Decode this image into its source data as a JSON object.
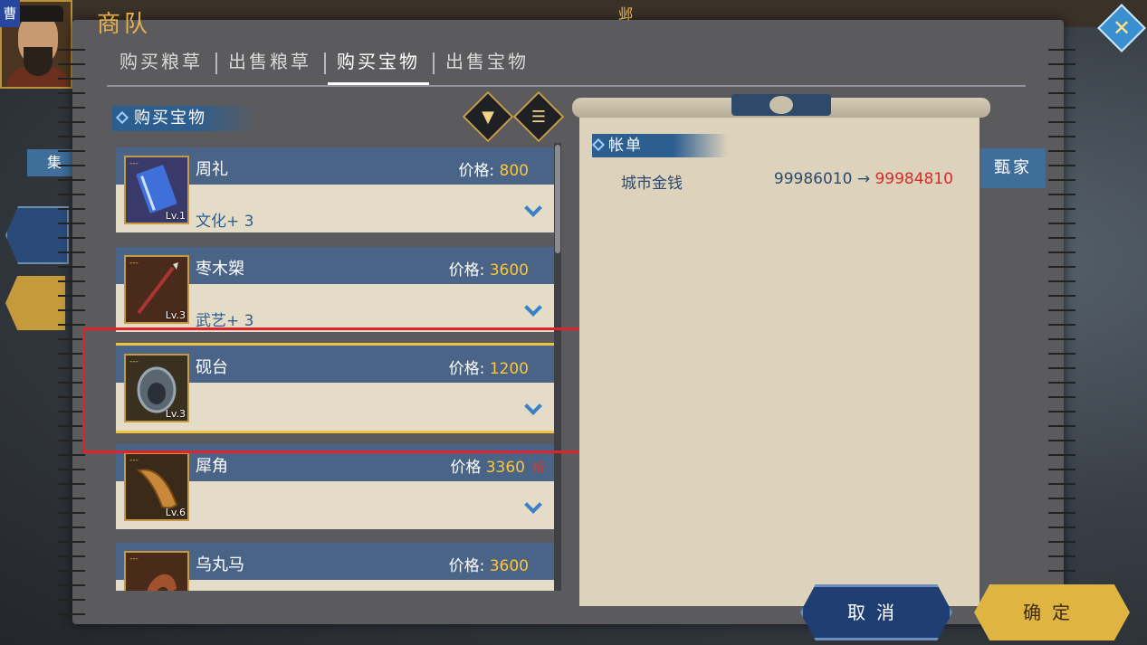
{
  "header": {
    "title": "商队",
    "city": "邺",
    "faction": "曹"
  },
  "tabs": [
    {
      "label": "购买粮草"
    },
    {
      "label": "出售粮草"
    },
    {
      "label": "购买宝物"
    },
    {
      "label": "出售宝物"
    }
  ],
  "section": {
    "label": "购买宝物"
  },
  "tools": {
    "filter_icon": "filter-icon",
    "list_icon": "list-icon"
  },
  "items": [
    {
      "name": "周礼",
      "price_label": "价格:",
      "price": "800",
      "attr": "文化+ 3",
      "level": "Lv.1",
      "icon": "book-icon",
      "dash": "---"
    },
    {
      "name": "枣木槊",
      "price_label": "价格:",
      "price": "3600",
      "attr": "武艺+ 3",
      "level": "Lv.3",
      "icon": "spear-icon",
      "dash": "---"
    },
    {
      "name": "砚台",
      "price_label": "价格:",
      "price": "1200",
      "attr": "",
      "level": "Lv.3",
      "icon": "inkstone-icon",
      "dash": "---"
    },
    {
      "name": "犀角",
      "price_label": "价格",
      "price": "3360",
      "discount": "折",
      "attr": "",
      "level": "Lv.6",
      "icon": "horn-icon",
      "dash": "---"
    },
    {
      "name": "乌丸马",
      "price_label": "价格:",
      "price": "3600",
      "attr": "",
      "level": "",
      "icon": "horse-icon",
      "dash": "---"
    }
  ],
  "bill": {
    "label": "帐单",
    "row_label": "城市金钱",
    "from": "99986010",
    "arrow": "→",
    "to": "99984810"
  },
  "side": {
    "right_tab": "甄家",
    "left_tab": "集"
  },
  "buttons": {
    "cancel": "取消",
    "ok": "确定"
  },
  "colors": {
    "accent": "#2d5e90",
    "price": "#ffc533",
    "selected": "#f1c23d",
    "new_value": "#d42a2a"
  }
}
